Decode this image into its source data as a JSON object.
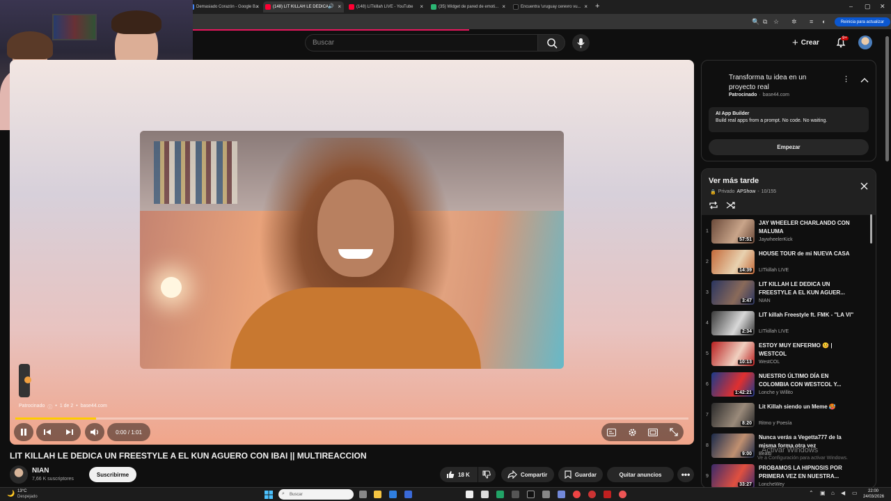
{
  "browser": {
    "tabs": [
      {
        "title": "Demasiado Corazón - Google B..."
      },
      {
        "title": "(148) LIT KILLAH LE DEDICA"
      },
      {
        "title": "(148) LITkillah LIVE - YouTube"
      },
      {
        "title": "(35) Widget de pared de emoti..."
      },
      {
        "title": "Encuentra 'uruguay cerevro vu..."
      }
    ],
    "new_tab": "+",
    "restart_label": "Reinicia para actualizar"
  },
  "header": {
    "search_placeholder": "Buscar",
    "create_label": "Crear",
    "notification_count": "9+"
  },
  "player": {
    "ad_label": "Patrocinado",
    "ad_count": "1 de 2",
    "ad_domain": "base44.com",
    "time": "0:00 / 1:01",
    "progress": 0.12,
    "progress_color": "#ffcc00"
  },
  "video": {
    "title": "LIT KILLAH LE DEDICA UN FREESTYLE A EL KUN AGUERO CON IBAI || MULTIREACCION",
    "channel": "NIAN",
    "subscribers": "7,66 K suscriptores",
    "subscribe_label": "Suscribirme",
    "likes": "18 K",
    "share_label": "Compartir",
    "save_label": "Guardar",
    "remove_ads_label": "Quitar anuncios"
  },
  "ad_card": {
    "headline": "Transforma tu idea en un proyecto real",
    "sponsored": "Patrocinado",
    "domain": "base44.com",
    "builder_title": "AI App Builder",
    "builder_desc": "Build real apps from a prompt. No code. No waiting.",
    "cta": "Empezar"
  },
  "playlist": {
    "title": "Ver más tarde",
    "privacy": "Privado",
    "owner": "APShow",
    "position": "10/155",
    "items": [
      {
        "n": "1",
        "title": "JAY WHEELER CHARLANDO CON MALUMA",
        "channel": "JaywheelerKick",
        "duration": "57:51",
        "c1": "#6b4a3a",
        "c2": "#c9a58a"
      },
      {
        "n": "2",
        "title": "HOUSE TOUR de mi NUEVA CASA",
        "channel": "LITkillah LIVE",
        "duration": "14:39",
        "c1": "#c46a3a",
        "c2": "#e8d2b0"
      },
      {
        "n": "3",
        "title": "LIT KILLAH LE DEDICA UN FREESTYLE A EL KUN AGUER...",
        "channel": "NIAN",
        "duration": "3:47",
        "c1": "#2a3560",
        "c2": "#8a6a5a"
      },
      {
        "n": "4",
        "title": "LIT killah Freestyle ft. FMK - \"LA VI\"",
        "channel": "LITkillah LIVE",
        "duration": "2:34",
        "c1": "#3a3a3a",
        "c2": "#d8d8d8"
      },
      {
        "n": "5",
        "title": "ESTOY MUY ENFERMO 🤒 | WESTCOL",
        "channel": "WestCOL",
        "duration": "10:13",
        "c1": "#b82020",
        "c2": "#f0d0c0"
      },
      {
        "n": "6",
        "title": "NUESTRO ÚLTIMO DÍA EN COLOMBIA CON WESTCOL Y...",
        "channel": "Lonche y Willito",
        "duration": "1:42:21",
        "c1": "#1a3a8a",
        "c2": "#e03030"
      },
      {
        "n": "7",
        "title": "Lit Killah siendo un Meme 🥵",
        "channel": "Ritmo y Poesía",
        "duration": "8:20",
        "c1": "#2a2a2a",
        "c2": "#9a8a7a"
      },
      {
        "n": "8",
        "title": "Nunca verás a Vegetta777 de la misma forma otra vez",
        "channel": "Beato",
        "duration": "9:00",
        "c1": "#1a2a4a",
        "c2": "#c09070"
      },
      {
        "n": "9",
        "title": "PROBAMOS LA HIPNOSIS POR PRIMERA VEZ EN NUESTRA...",
        "channel": "LoncheWey",
        "duration": "33:27",
        "c1": "#3a2a6a",
        "c2": "#e05040"
      }
    ]
  },
  "overlay": {
    "activate_title": "Activar Windows",
    "activate_sub": "Ve a Configuración para activar Windows."
  },
  "taskbar": {
    "weather_temp": "13°C",
    "weather_desc": "Despejado",
    "search_placeholder": "Buscar",
    "time": "22:00",
    "date": "24/03/2026"
  }
}
